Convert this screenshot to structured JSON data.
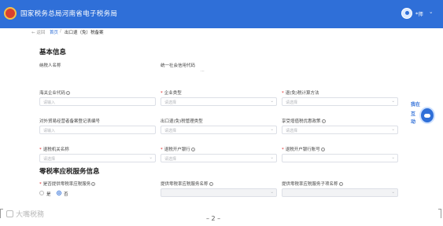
{
  "header": {
    "site_title": "国家税务总局河南省电子税务局",
    "user_name": "*师",
    "user_chevron": "⌄"
  },
  "breadcrumb": {
    "back": "← 返回",
    "home": "首页",
    "sep": "/",
    "current": "出口退（免）税备案"
  },
  "basic_info": {
    "title": "基本信息",
    "taxpayer_name_label": "纳税人名称",
    "credit_code_label": "统一社会信用代码",
    "credit_code_value": "···",
    "customs_code_label": "海关企业代码",
    "customs_code_placeholder": "请输入",
    "enterprise_type_label": "企业类型",
    "enterprise_type_placeholder": "请选择",
    "refund_method_label": "退(免)税计算方法",
    "refund_method_placeholder": "请选择",
    "trade_reg_label": "对外贸易经营者备案登记表编号",
    "trade_reg_placeholder": "请输入",
    "export_mgmt_label": "出口退(免)税管理类型",
    "export_mgmt_placeholder": "请选择",
    "policy_label": "享受增值税优惠政策",
    "policy_placeholder": "请选择",
    "tax_office_label": "退税机关名称",
    "tax_office_placeholder": "请选择",
    "bank_label": "退税开户银行",
    "bank_placeholder": "请选择",
    "account_label": "退税开户银行账号",
    "account_placeholder": ""
  },
  "zero_rate": {
    "title": "零税率应税服务信息",
    "provide_label": "是否提供零税率应税服务",
    "yes_label": "是",
    "no_label": "否",
    "selected": "否",
    "service_name_label": "提供零税率应税服务名称",
    "service_code_label": "提供零税率应税服务子项名称"
  },
  "chat_widget": {
    "line1": "我在",
    "line2": "互",
    "line3": "动"
  },
  "footer": {
    "watermark": "大嘴税務",
    "page_number": "– 2 –"
  },
  "icons": {
    "info": "i",
    "chevron": "⌄"
  },
  "colors": {
    "brand_blue": "#2f6fd8",
    "required_red": "#e02424"
  }
}
